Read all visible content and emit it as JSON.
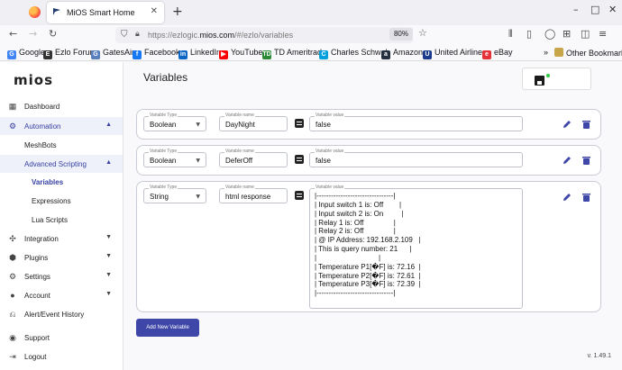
{
  "browser": {
    "tab_title": "MiOS Smart Home",
    "url_prefix": "https://ezlogic.",
    "url_domain": "mios.com",
    "url_suffix": "/#/ezlo/variables",
    "zoom": "80%",
    "bookmarks": [
      {
        "label": "Google",
        "icon": "google-icon",
        "color": "#4285f4"
      },
      {
        "label": "Ezlo Forum",
        "icon": "ezlo-icon",
        "color": "#333333"
      },
      {
        "label": "GatesAir",
        "icon": "gatesair-icon",
        "color": "#5a7fbf"
      },
      {
        "label": "Facebook",
        "icon": "facebook-icon",
        "color": "#1877f2"
      },
      {
        "label": "LinkedIn",
        "icon": "linkedin-icon",
        "color": "#0a66c2"
      },
      {
        "label": "YouTube",
        "icon": "youtube-icon",
        "color": "#ff0000"
      },
      {
        "label": "TD Ameritrade",
        "icon": "td-icon",
        "color": "#2d8a34"
      },
      {
        "label": "Charles Schwab",
        "icon": "schwab-icon",
        "color": "#00a0df"
      },
      {
        "label": "Amazon",
        "icon": "amazon-icon",
        "color": "#232f3e"
      },
      {
        "label": "United Airlines",
        "icon": "united-icon",
        "color": "#1a3b8c"
      },
      {
        "label": "eBay",
        "icon": "ebay-icon",
        "color": "#e53238"
      }
    ],
    "other_bookmarks": "Other Bookmarks"
  },
  "sidebar": {
    "logo": "mios",
    "items": [
      {
        "label": "Dashboard",
        "icon": "dashboard-icon"
      },
      {
        "label": "Automation",
        "icon": "automation-icon"
      },
      {
        "label": "MeshBots"
      },
      {
        "label": "Advanced Scripting"
      },
      {
        "label": "Variables"
      },
      {
        "label": "Expressions"
      },
      {
        "label": "Lua Scripts"
      },
      {
        "label": "Integration",
        "icon": "integration-icon"
      },
      {
        "label": "Plugins",
        "icon": "plugins-icon"
      },
      {
        "label": "Settings",
        "icon": "settings-icon"
      },
      {
        "label": "Account",
        "icon": "account-icon"
      },
      {
        "label": "Alert/Event History",
        "icon": "history-icon"
      },
      {
        "label": "Support",
        "icon": "support-icon"
      },
      {
        "label": "Logout",
        "icon": "logout-icon"
      }
    ],
    "version": "v. 1.49.1"
  },
  "main": {
    "title": "Variables",
    "labels": {
      "type": "Variable Type",
      "name": "Variable name",
      "value": "Variable value"
    },
    "variables": [
      {
        "type": "Boolean",
        "name": "DayNight",
        "value": "false"
      },
      {
        "type": "Boolean",
        "name": "DeferOff",
        "value": "false"
      },
      {
        "type": "String",
        "name": "html response",
        "value": "|--------------------------------|\n| Input switch 1 is: Off        |\n| Input switch 2 is: On         |\n| Relay 1 is: Off               |\n| Relay 2 is: Off               |\n| @ IP Address: 192.168.2.109   |\n| This is query number: 21      |\n|                               |\n| Temperature P1[\u0000F] is: 72.16  |\n| Temperature P2[\u0000F] is: 72.61  |\n| Temperature P3[\u0000F] is: 72.39  |\n|--------------------------------|"
      }
    ],
    "add_button": "Add New Variable"
  },
  "colors": {
    "accent": "#3e46a8",
    "active_bg": "#eef0fa",
    "save_indicator": "#2ecc40"
  }
}
